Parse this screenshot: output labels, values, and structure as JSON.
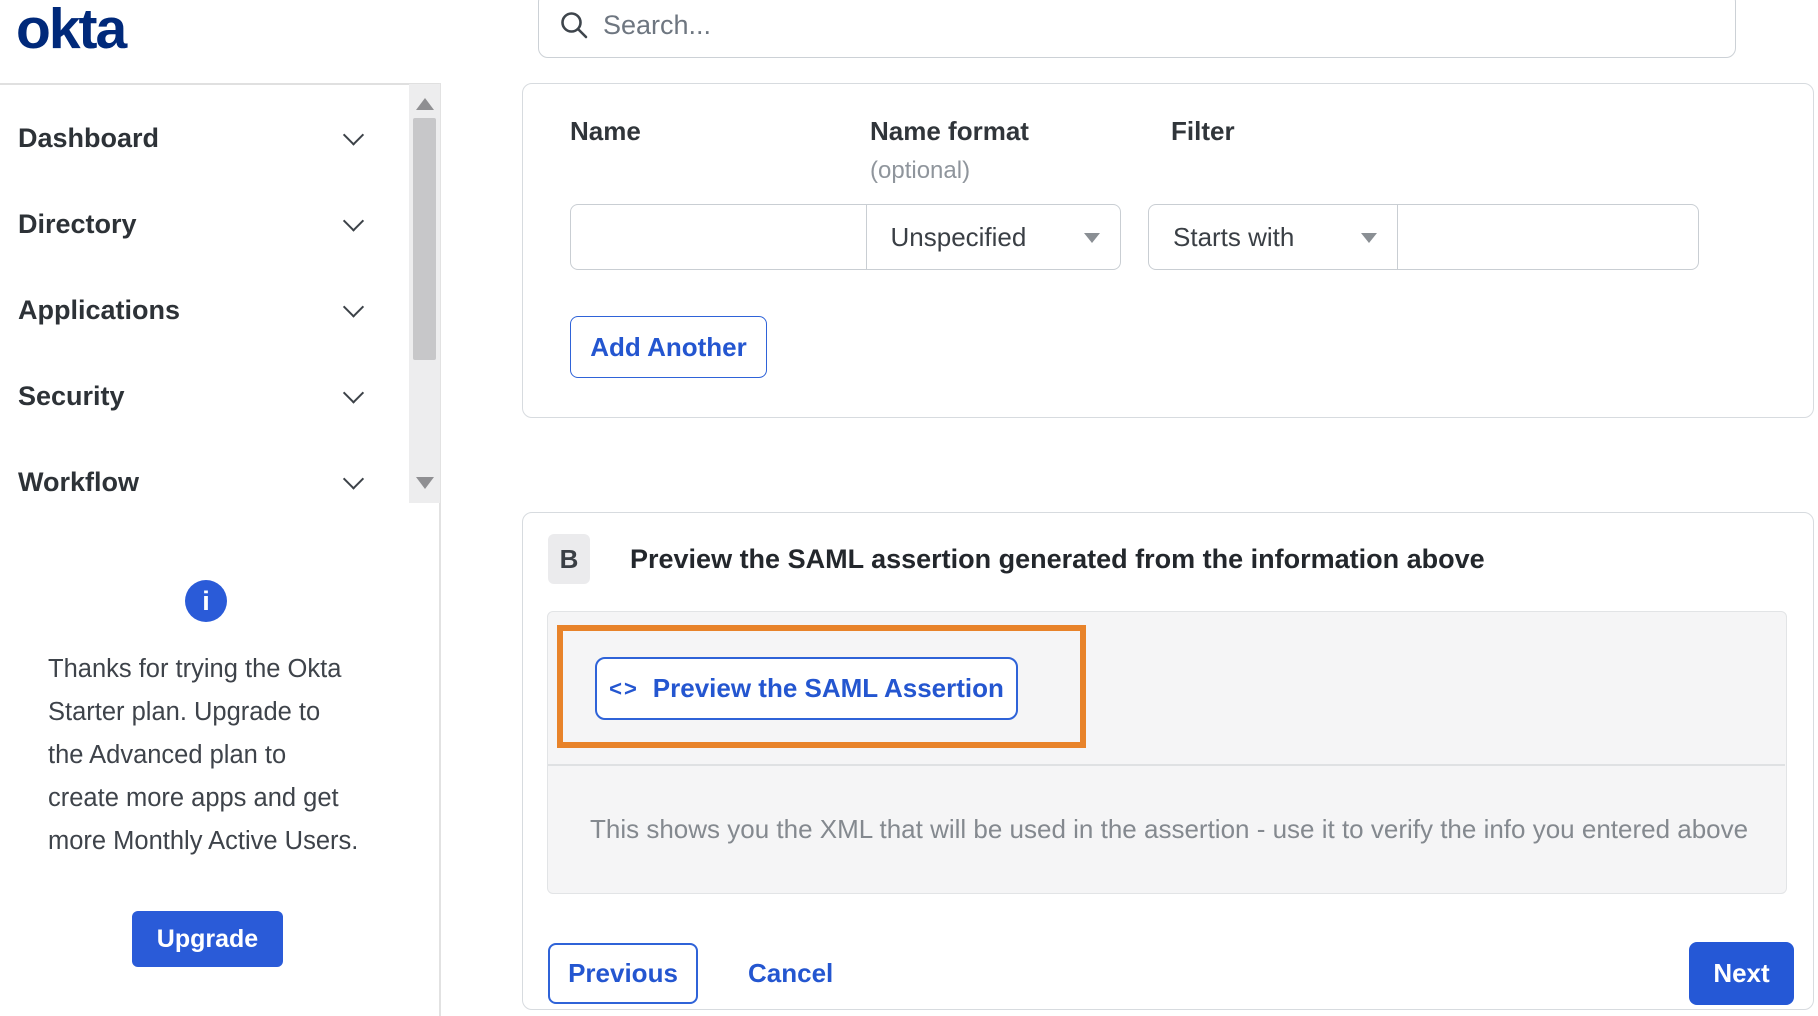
{
  "brand": {
    "logo_text": "okta"
  },
  "header": {
    "search_placeholder": "Search..."
  },
  "sidebar": {
    "nav_items": [
      {
        "label": "Dashboard"
      },
      {
        "label": "Directory"
      },
      {
        "label": "Applications"
      },
      {
        "label": "Security"
      },
      {
        "label": "Workflow"
      }
    ],
    "upsell": {
      "message": "Thanks for trying the Okta\nStarter plan. Upgrade to\nthe Advanced plan to\ncreate more apps and get\nmore Monthly Active Users.",
      "button_label": "Upgrade"
    }
  },
  "attribute_form": {
    "name_label": "Name",
    "name_format_label": "Name format",
    "name_format_hint": "(optional)",
    "filter_label": "Filter",
    "name_value": "",
    "name_format_value": "Unspecified",
    "filter_operator": "Starts with",
    "filter_value": "",
    "add_another_label": "Add Another"
  },
  "preview_section": {
    "badge": "B",
    "heading": "Preview the SAML assertion generated from the information above",
    "preview_button_label": "Preview the SAML Assertion",
    "description": "This shows you the XML that will be used in the assertion - use it to verify the info you entered above"
  },
  "wizard_footer": {
    "previous_label": "Previous",
    "cancel_label": "Cancel",
    "next_label": "Next"
  },
  "icons": {
    "info_glyph": "i",
    "code_glyph": "<>"
  },
  "colors": {
    "accent_blue": "#2a5bd8",
    "brand_navy": "#00297a",
    "highlight_orange": "#e8832a",
    "panel_gray": "#f5f5f6"
  }
}
